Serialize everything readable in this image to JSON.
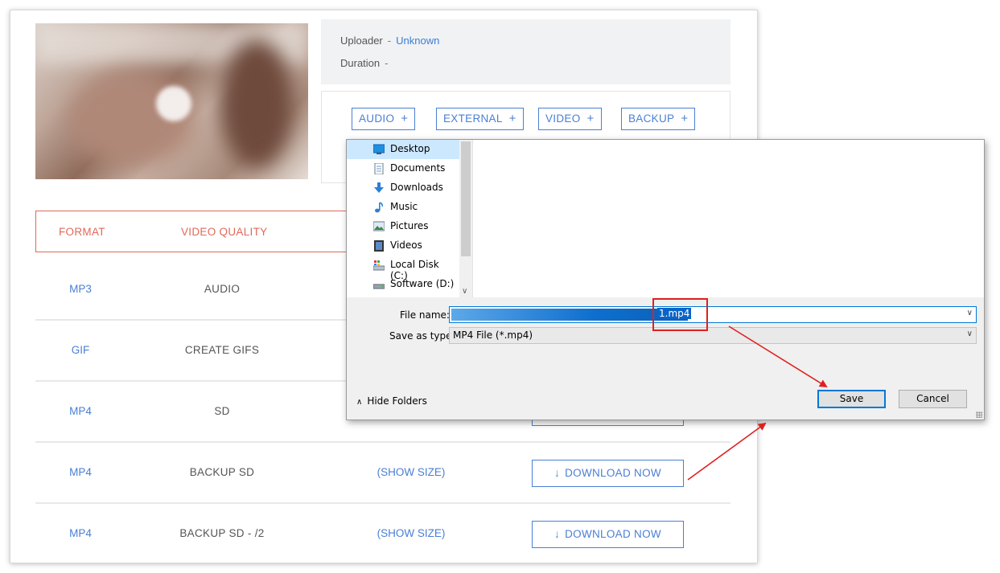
{
  "meta": {
    "uploader_label": "Uploader",
    "uploader_sep": "-",
    "uploader_value": "Unknown",
    "duration_label": "Duration",
    "duration_sep": "-"
  },
  "tags": [
    "AUDIO",
    "EXTERNAL",
    "VIDEO",
    "BACKUP"
  ],
  "table": {
    "headers": {
      "format": "FORMAT",
      "quality": "VIDEO QUALITY"
    },
    "rows": [
      {
        "format": "MP3",
        "quality": "AUDIO",
        "size": "",
        "download": ""
      },
      {
        "format": "GIF",
        "quality": "CREATE GIFS",
        "size": "",
        "download": ""
      },
      {
        "format": "MP4",
        "quality": "SD",
        "size": "",
        "download": ""
      },
      {
        "format": "MP4",
        "quality": "BACKUP SD",
        "size": "(SHOW SIZE)",
        "download": "DOWNLOAD NOW"
      },
      {
        "format": "MP4",
        "quality": "BACKUP SD - /2",
        "size": "(SHOW SIZE)",
        "download": "DOWNLOAD NOW"
      }
    ]
  },
  "dialog": {
    "nav_items": [
      {
        "label": "Desktop",
        "icon": "desktop-icon",
        "selected": true
      },
      {
        "label": "Documents",
        "icon": "documents-icon"
      },
      {
        "label": "Downloads",
        "icon": "downloads-icon"
      },
      {
        "label": "Music",
        "icon": "music-icon"
      },
      {
        "label": "Pictures",
        "icon": "pictures-icon"
      },
      {
        "label": "Videos",
        "icon": "videos-icon"
      },
      {
        "label": "Local Disk (C:)",
        "icon": "local-disk-icon"
      },
      {
        "label": "Software (D:)",
        "icon": "drive-icon"
      }
    ],
    "file_name_label": "File name:",
    "file_name_value": "1.mp4",
    "save_type_label": "Save as type:",
    "save_type_value": "MP4 File (*.mp4)",
    "hide_folders": "Hide Folders",
    "save_button": "Save",
    "cancel_button": "Cancel"
  },
  "colors": {
    "accent_blue": "#4a7fd4",
    "header_red": "#e0695a",
    "annotation_red": "#e02020",
    "selection_blue": "#0078d7"
  }
}
